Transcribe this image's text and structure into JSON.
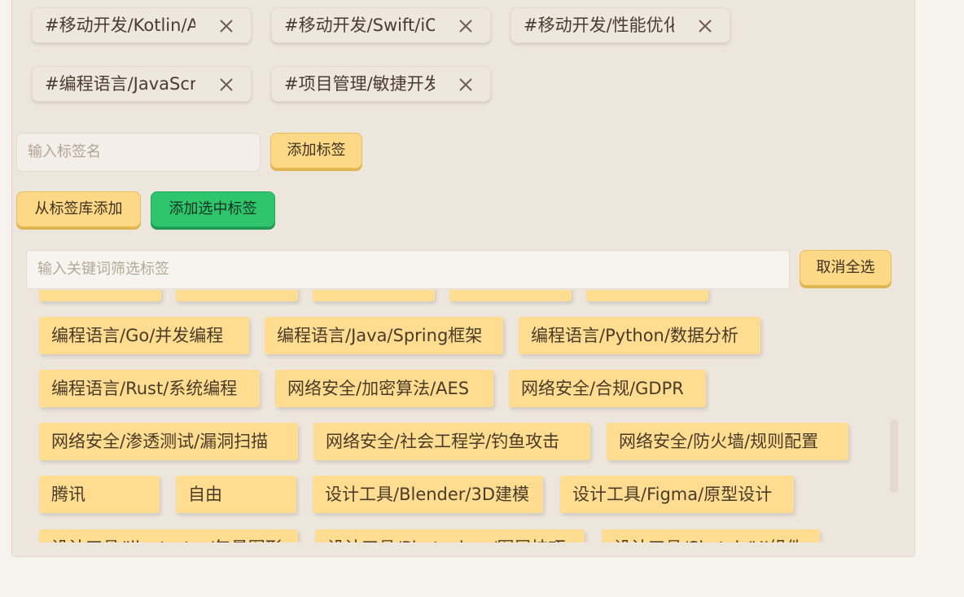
{
  "selected_tags": [
    {
      "label": "#移动开发/Kotlin/Android"
    },
    {
      "label": "#移动开发/Swift/iOS"
    },
    {
      "label": "#移动开发/性能优化"
    },
    {
      "label": "#编程语言/JavaScript"
    },
    {
      "label": "#项目管理/敏捷开发"
    }
  ],
  "tag_input": {
    "placeholder": "输入标签名"
  },
  "buttons": {
    "add_tag": "添加标签",
    "add_from_library": "从标签库添加",
    "add_selected": "添加选中标签",
    "deselect_all": "取消全选"
  },
  "filter": {
    "placeholder": "输入关键词筛选标签"
  },
  "library_tags": [
    "编程语言/Go/并发编程",
    "编程语言/Java/Spring框架",
    "编程语言/Python/数据分析",
    "编程语言/Rust/系统编程",
    "网络安全/加密算法/AES",
    "网络安全/合规/GDPR",
    "网络安全/渗透测试/漏洞扫描",
    "网络安全/社会工程学/钓鱼攻击",
    "网络安全/防火墙/规则配置",
    "腾讯",
    "自由",
    "设计工具/Blender/3D建模",
    "设计工具/Figma/原型设计",
    "设计工具/Illustrator/矢量图形",
    "设计工具/Photoshop/图层技巧",
    "设计工具/Sketch/UI组件"
  ],
  "colors": {
    "accent_yellow": "#fdd886",
    "accent_green": "#2ec56d",
    "panel": "#ede6dd"
  }
}
